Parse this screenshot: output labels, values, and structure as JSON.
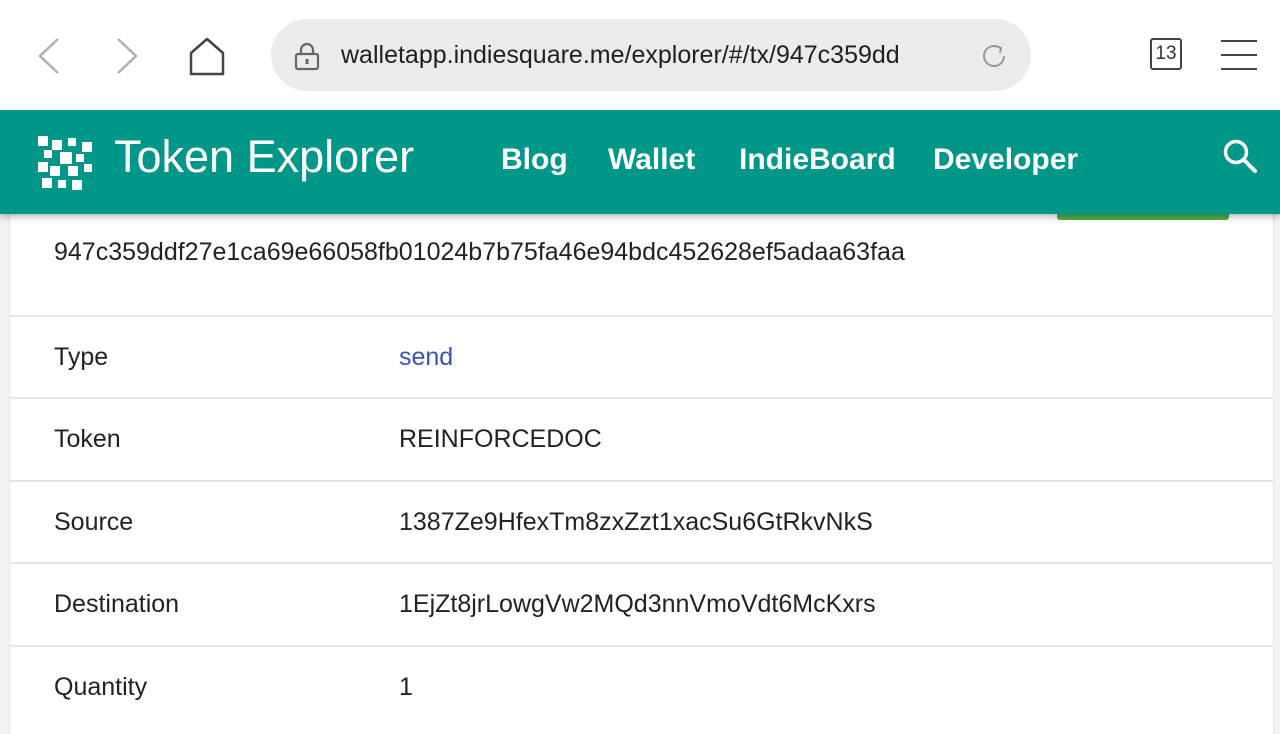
{
  "browser": {
    "url": "walletapp.indiesquare.me/explorer/#/tx/947c359dd",
    "tab_count": "13"
  },
  "header": {
    "title": "Token Explorer",
    "nav": [
      "Blog",
      "Wallet",
      "IndieBoard",
      "Developer"
    ],
    "accent_color": "#009688"
  },
  "tx": {
    "hash": "947c359ddf27e1ca69e66058fb01024b7b75fa46e94bdc452628ef5adaa63faa",
    "rows": [
      {
        "label": "Type",
        "value": "send"
      },
      {
        "label": "Token",
        "value": "REINFORCEDOC"
      },
      {
        "label": "Source",
        "value": "1387Ze9HfexTm8zxZzt1xacSu6GtRkvNkS"
      },
      {
        "label": "Destination",
        "value": "1EjZt8jrLowgVw2MQd3nnVmoVdt6McKxrs"
      },
      {
        "label": "Quantity",
        "value": "1"
      }
    ]
  },
  "icons": [
    "back-icon",
    "forward-icon",
    "home-icon",
    "lock-icon",
    "reload-icon",
    "menu-icon",
    "search-icon",
    "logo-icon"
  ]
}
